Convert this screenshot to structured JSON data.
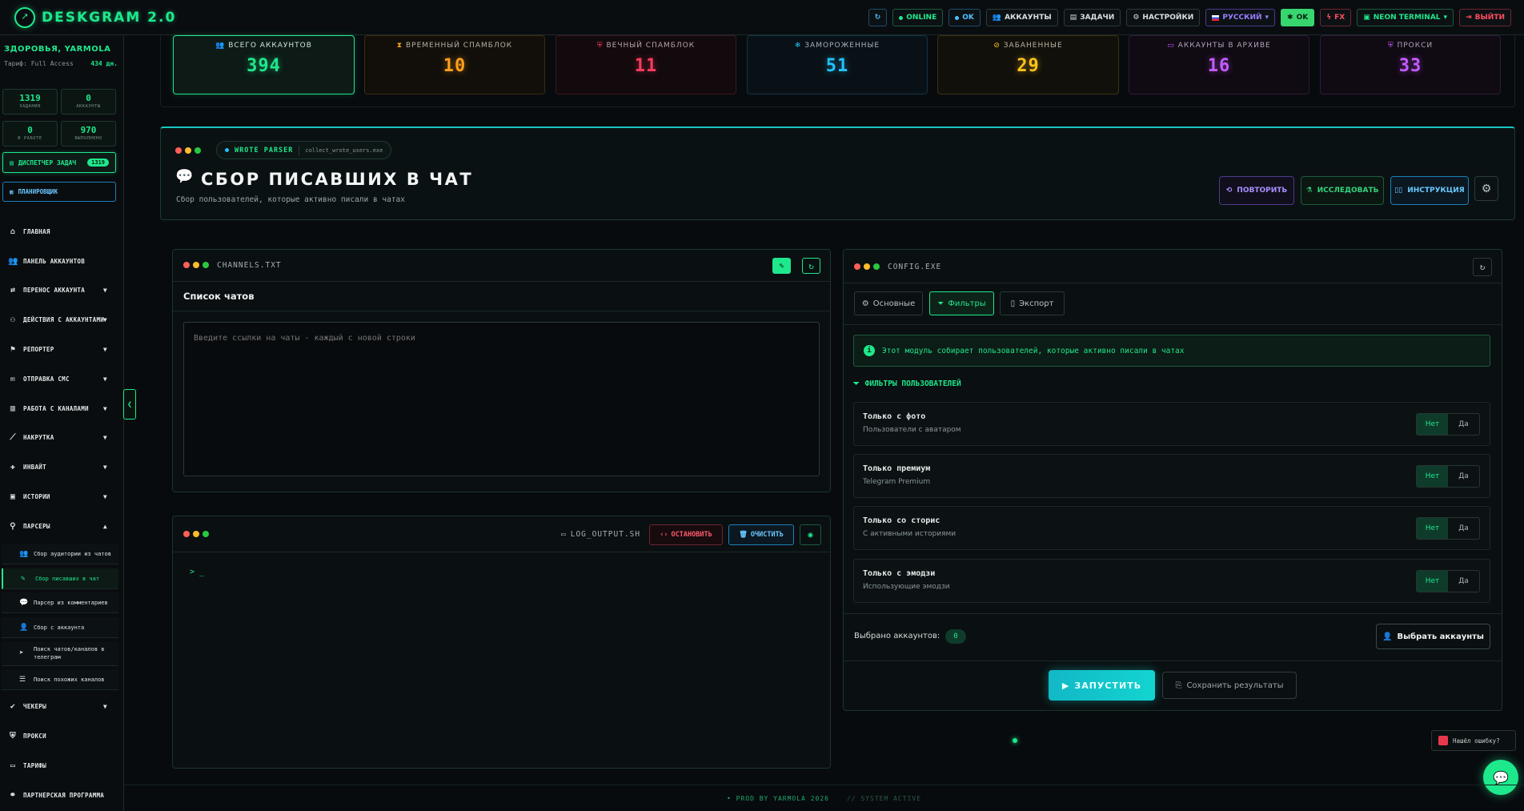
{
  "app": {
    "title": "DESKGRAM 2.0",
    "logo_icon": "rocket-icon"
  },
  "header": {
    "online": "ONLINE",
    "ok": "OK",
    "accounts": "АККАУНТЫ",
    "tasks": "ЗАДАЧИ",
    "settings": "НАСТРОЙКИ",
    "language": "РУССКИЙ",
    "ok2": "OK",
    "fx": "FX",
    "theme": "NEON TERMINAL",
    "logout": "ВЫЙТИ"
  },
  "sidebar": {
    "greeting": "ЗДОРОВЬЯ, YARMOLA",
    "tarif": "Тариф: Full Access",
    "days": "434 дн.",
    "stats": [
      {
        "value": "1319",
        "label": "ЗАДАНИЯ"
      },
      {
        "value": "0",
        "label": "АККАУНТЫ"
      },
      {
        "value": "0",
        "label": "В РАБОТЕ"
      },
      {
        "value": "970",
        "label": "ВЫПОЛНЕНО"
      }
    ],
    "dispatcher": "ДИСПЕТЧЕР ЗАДАЧ",
    "dispatcher_count": "1319",
    "planner": "ПЛАНИРОВЩИК",
    "nav": [
      {
        "label": "ГЛАВНАЯ"
      },
      {
        "label": "ПАНЕЛЬ АККАУНТОВ"
      },
      {
        "label": "ПЕРЕНОС АККАУНТА"
      },
      {
        "label": "ДЕЙСТВИЯ С АККАУНТАМИ"
      },
      {
        "label": "РЕПОРТЕР"
      },
      {
        "label": "ОТПРАВКА СМС"
      },
      {
        "label": "РАБОТА С КАНАЛАМИ"
      },
      {
        "label": "НАКРУТКА"
      },
      {
        "label": "ИНВАЙТ"
      },
      {
        "label": "ИСТОРИИ"
      },
      {
        "label": "ПАРСЕРЫ"
      },
      {
        "label": "ЧЕКЕРЫ"
      },
      {
        "label": "ПРОКСИ"
      },
      {
        "label": "ТАРИФЫ"
      },
      {
        "label": "ПАРТНЕРСКАЯ ПРОГРАММА"
      }
    ],
    "parsers": [
      {
        "label": "Сбор аудитории из чатов"
      },
      {
        "label": "Сбор писавших в чат"
      },
      {
        "label": "Парсер из комментариев"
      },
      {
        "label": "Сбор с аккаунта"
      },
      {
        "label": "Поиск чатов/каналов в телеграм"
      },
      {
        "label": "Поиск похожих каналов"
      }
    ]
  },
  "stats": [
    {
      "label": "ВСЕГО АККАУНТОВ",
      "value": "394",
      "color": "#1ee88c"
    },
    {
      "label": "ВРЕМЕННЫЙ СПАМБЛОК",
      "value": "10",
      "color": "#ff9f1a"
    },
    {
      "label": "ВЕЧНЫЙ СПАМБЛОК",
      "value": "11",
      "color": "#ff3b5c"
    },
    {
      "label": "ЗАМОРОЖЕННЫЕ",
      "value": "51",
      "color": "#22c3ff"
    },
    {
      "label": "ЗАБАНЕННЫЕ",
      "value": "29",
      "color": "#ffc21a"
    },
    {
      "label": "АККАУНТЫ В АРХИВЕ",
      "value": "16",
      "color": "#c45bff"
    },
    {
      "label": "ПРОКСИ",
      "value": "33",
      "color": "#c45bff"
    }
  ],
  "hero": {
    "tag": "WROTE PARSER",
    "file": "collect_wrote_users.exe",
    "title": "СБОР ПИСАВШИХ В ЧАТ",
    "subtitle": "Сбор пользователей, которые активно писали в чатах",
    "repeat": "ПОВТОРИТЬ",
    "research": "ИССЛЕДОВАТЬ",
    "instruction": "ИНСТРУКЦИЯ"
  },
  "channels": {
    "filename": "CHANNELS.TXT",
    "section_title": "Список чатов",
    "placeholder": "Введите ссылки на чаты - каждый с новой строки"
  },
  "log": {
    "filename": "LOG_OUTPUT.SH",
    "stop": "ОСТАНОВИТЬ",
    "clear": "ОЧИСТИТЬ",
    "prompt": "> _"
  },
  "config": {
    "filename": "CONFIG.EXE",
    "tabs": [
      "Основные",
      "Фильтры",
      "Экспорт"
    ],
    "info": "Этот модуль собирает пользователей, которые активно писали в чатах",
    "filters_title": "ФИЛЬТРЫ ПОЛЬЗОВАТЕЛЕЙ",
    "filters": [
      {
        "title": "Только с фото",
        "sub": "Пользователи с аватаром",
        "no": "Нет",
        "yes": "Да"
      },
      {
        "title": "Только премиум",
        "sub": "Telegram Premium",
        "no": "Нет",
        "yes": "Да"
      },
      {
        "title": "Только со сторис",
        "sub": "С активными историями",
        "no": "Нет",
        "yes": "Да"
      },
      {
        "title": "Только с эмодзи",
        "sub": "Использующие эмодзи",
        "no": "Нет",
        "yes": "Да"
      }
    ],
    "selected_label": "Выбрано аккаунтов:",
    "selected_count": "0",
    "choose": "Выбрать аккаунты",
    "run": "ЗАПУСТИТЬ",
    "save": "Сохранить результаты"
  },
  "report": "Нашёл ошибку?",
  "footer": {
    "left": "PROD BY YARMOLA 2026",
    "right": "// SYSTEM ACTIVE"
  }
}
